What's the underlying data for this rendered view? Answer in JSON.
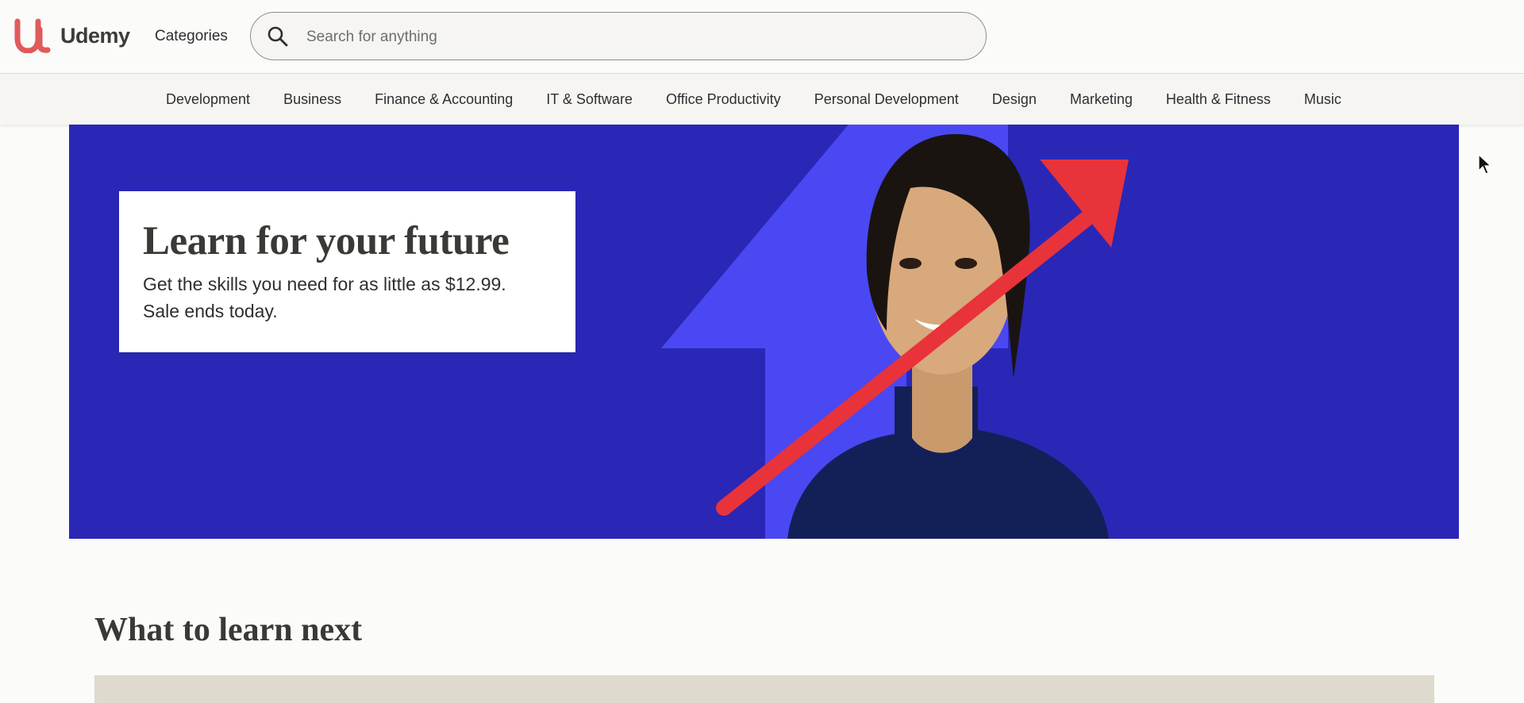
{
  "header": {
    "logo_text": "Udemy",
    "categories_label": "Categories",
    "search": {
      "placeholder": "Search for anything",
      "icon": "search-icon"
    }
  },
  "category_nav": [
    "Development",
    "Business",
    "Finance & Accounting",
    "IT & Software",
    "Office Productivity",
    "Personal Development",
    "Design",
    "Marketing",
    "Health & Fitness",
    "Music"
  ],
  "hero": {
    "title": "Learn for your future",
    "subtitle_line1": "Get the skills you need for as little as $12.99.",
    "subtitle_line2": "Sale ends today.",
    "colors": {
      "background": "#2a27b6",
      "shape": "#4a48f2",
      "arrow": "#e8333a"
    }
  },
  "section": {
    "title": "What to learn next"
  },
  "colors": {
    "brand": "#a435f0",
    "logo_mark": "#e05a5a",
    "page_bg": "#fbfbf9"
  }
}
